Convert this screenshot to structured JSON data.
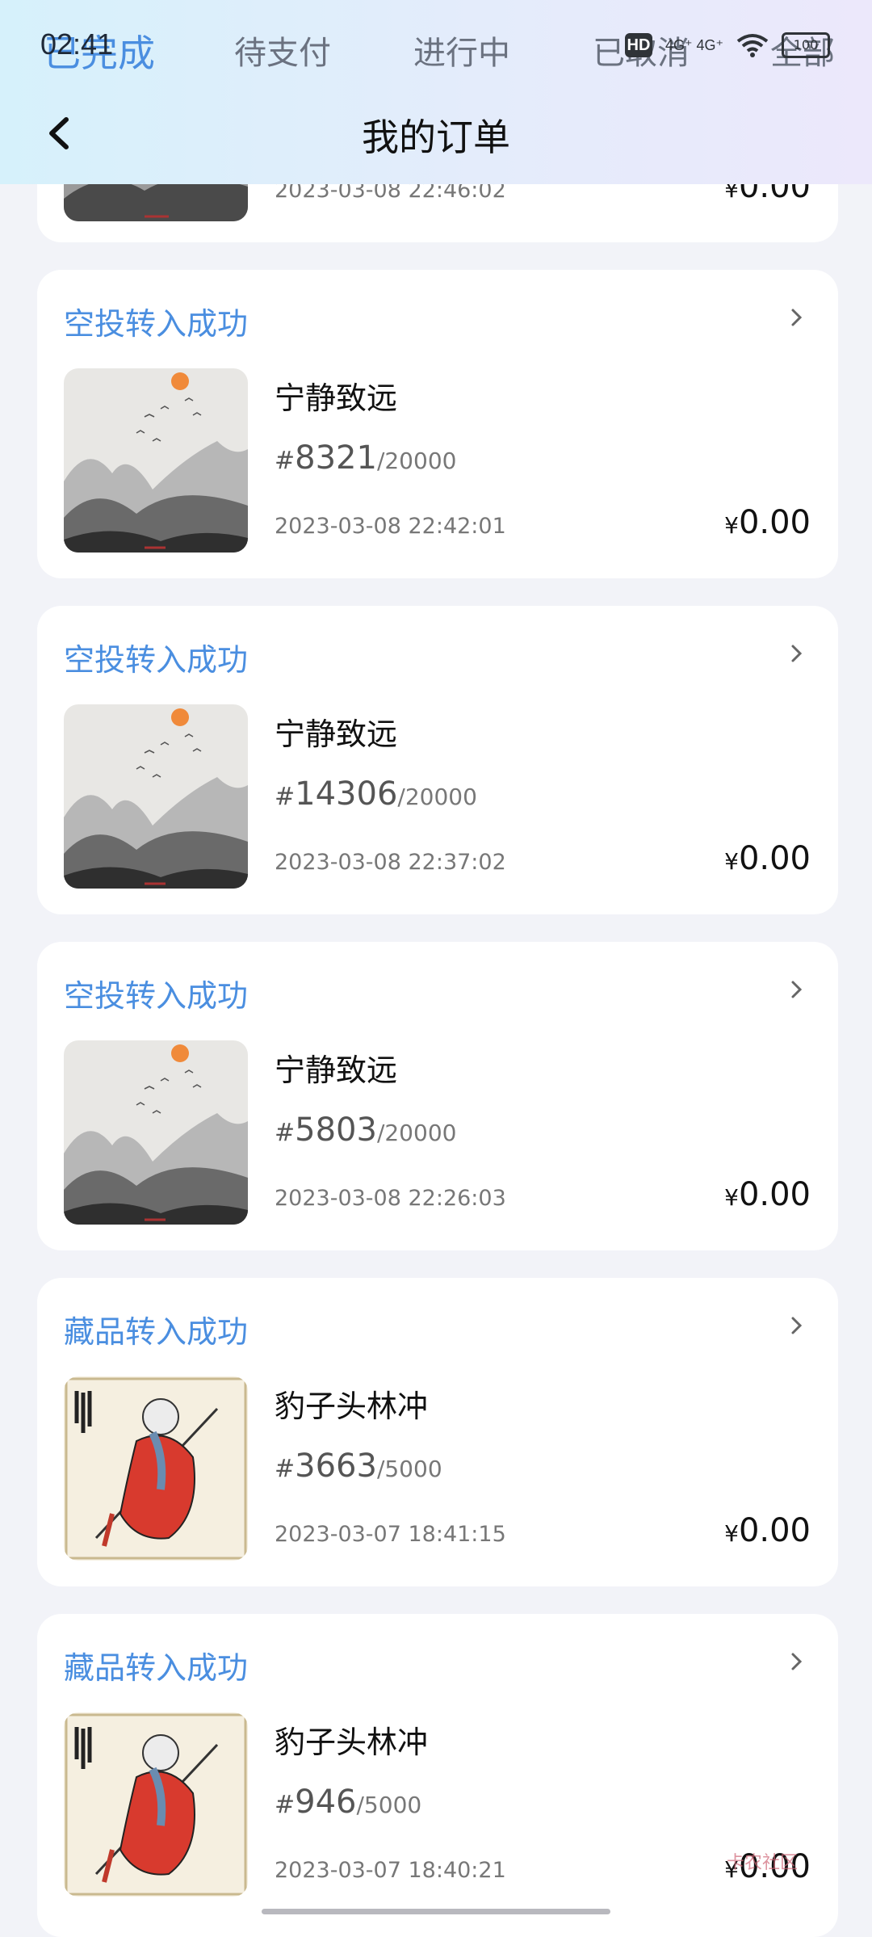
{
  "status_bar": {
    "time": "02:41",
    "hd": "HD",
    "signal": "4G⁺ 4G⁺",
    "battery": "100"
  },
  "tabs": [
    {
      "label": "已完成",
      "active": true
    },
    {
      "label": "待支付",
      "active": false
    },
    {
      "label": "进行中",
      "active": false
    },
    {
      "label": "已取消",
      "active": false
    },
    {
      "label": "全部",
      "active": false
    }
  ],
  "header": {
    "title": "我的订单"
  },
  "partial_order": {
    "date": "2023-03-08 22:46:02",
    "currency": "¥",
    "price": "0.00"
  },
  "orders": [
    {
      "status": "空投转入成功",
      "name": "宁静致远",
      "hash": "#",
      "serial": "8321",
      "total": "/20000",
      "date": "2023-03-08 22:42:01",
      "currency": "¥",
      "price": "0.00",
      "image": "ink-mountain-painting"
    },
    {
      "status": "空投转入成功",
      "name": "宁静致远",
      "hash": "#",
      "serial": "14306",
      "total": "/20000",
      "date": "2023-03-08 22:37:02",
      "currency": "¥",
      "price": "0.00",
      "image": "ink-mountain-painting"
    },
    {
      "status": "空投转入成功",
      "name": "宁静致远",
      "hash": "#",
      "serial": "5803",
      "total": "/20000",
      "date": "2023-03-08 22:26:03",
      "currency": "¥",
      "price": "0.00",
      "image": "ink-mountain-painting"
    },
    {
      "status": "藏品转入成功",
      "name": "豹子头林冲",
      "hash": "#",
      "serial": "3663",
      "total": "/5000",
      "date": "2023-03-07 18:41:15",
      "currency": "¥",
      "price": "0.00",
      "image": "lin-chong-illustration"
    },
    {
      "status": "藏品转入成功",
      "name": "豹子头林冲",
      "hash": "#",
      "serial": "946",
      "total": "/5000",
      "date": "2023-03-07 18:40:21",
      "currency": "¥",
      "price": "0.00",
      "image": "lin-chong-illustration"
    }
  ],
  "watermark": "卡农社区",
  "colors": {
    "accent": "#4a8ee0",
    "background": "#f2f3f8"
  }
}
